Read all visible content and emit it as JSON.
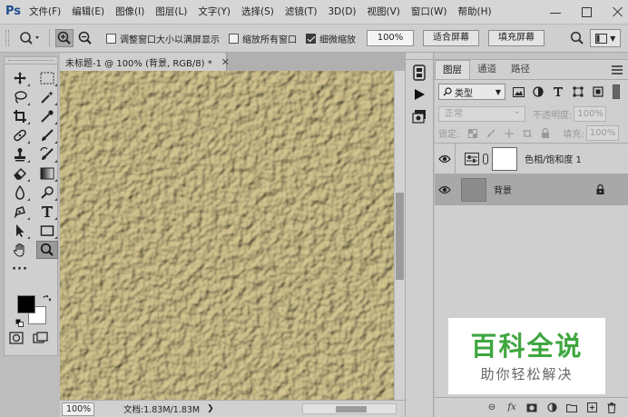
{
  "app": {
    "logo": "Ps"
  },
  "menu": [
    "文件(F)",
    "编辑(E)",
    "图像(I)",
    "图层(L)",
    "文字(Y)",
    "选择(S)",
    "滤镜(T)",
    "3D(D)",
    "视图(V)",
    "窗口(W)",
    "帮助(H)"
  ],
  "options": {
    "resize_windows_label": "调整窗口大小以满屏显示",
    "resize_windows_checked": false,
    "zoom_all_label": "缩放所有窗口",
    "zoom_all_checked": false,
    "scrubby_label": "细微缩放",
    "scrubby_checked": true,
    "zoom_value": "100%",
    "fit_screen_label": "适合屏幕",
    "fill_screen_label": "填充屏幕"
  },
  "document": {
    "tab_title": "未标题-1 @ 100% (背景, RGB/8) *",
    "zoom": "100%",
    "doc_info": "文档:1.83M/1.83M",
    "canvas_color": "#b8a878"
  },
  "layers_panel": {
    "tabs": [
      "图层",
      "通道",
      "路径"
    ],
    "filter_label": "类型",
    "blend_mode": "正常",
    "opacity_label": "不透明度:",
    "opacity_value": "100%",
    "lock_label": "锁定:",
    "fill_label": "填充:",
    "fill_value": "100%",
    "layers": [
      {
        "name": "色相/饱和度 1",
        "type": "adjustment",
        "selected": false
      },
      {
        "name": "背景",
        "type": "background",
        "selected": true,
        "locked": true
      }
    ]
  },
  "watermark": {
    "title": "百科全说",
    "subtitle": "助你轻松解决"
  },
  "colors": {
    "foreground": "#000000",
    "background": "#ffffff"
  }
}
